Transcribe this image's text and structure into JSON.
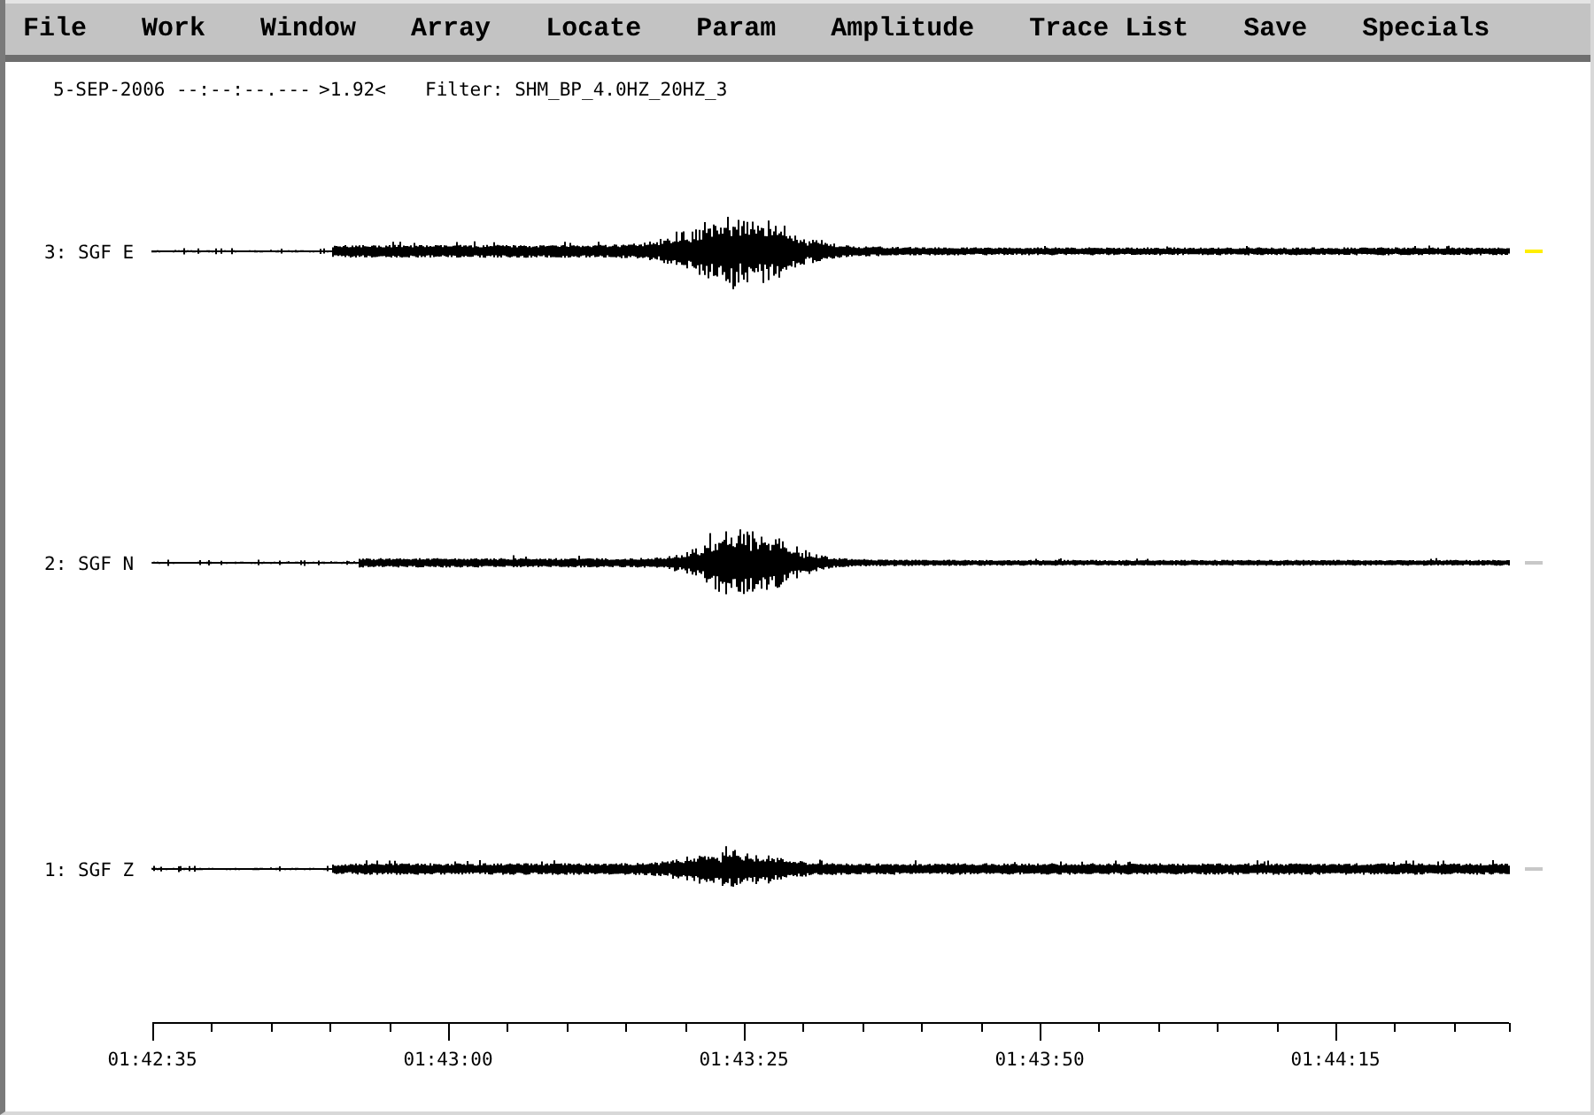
{
  "menu": [
    "File",
    "Work",
    "Window",
    "Array",
    "Locate",
    "Param",
    "Amplitude",
    "Trace List",
    "Save",
    "Specials"
  ],
  "info": {
    "date_time": "5-SEP-2006 --:--:--.---",
    "scale": ">1.92<",
    "filter": "Filter: SHM_BP_4.0HZ_20HZ_3"
  },
  "traces": [
    {
      "label": "3: SGF E",
      "selected": true
    },
    {
      "label": "2: SGF N",
      "selected": false
    },
    {
      "label": "1: SGF Z",
      "selected": false
    }
  ],
  "time_axis": {
    "labels": [
      "01:42:35",
      "01:43:00",
      "01:43:25",
      "01:43:50",
      "01:44:15"
    ]
  }
}
